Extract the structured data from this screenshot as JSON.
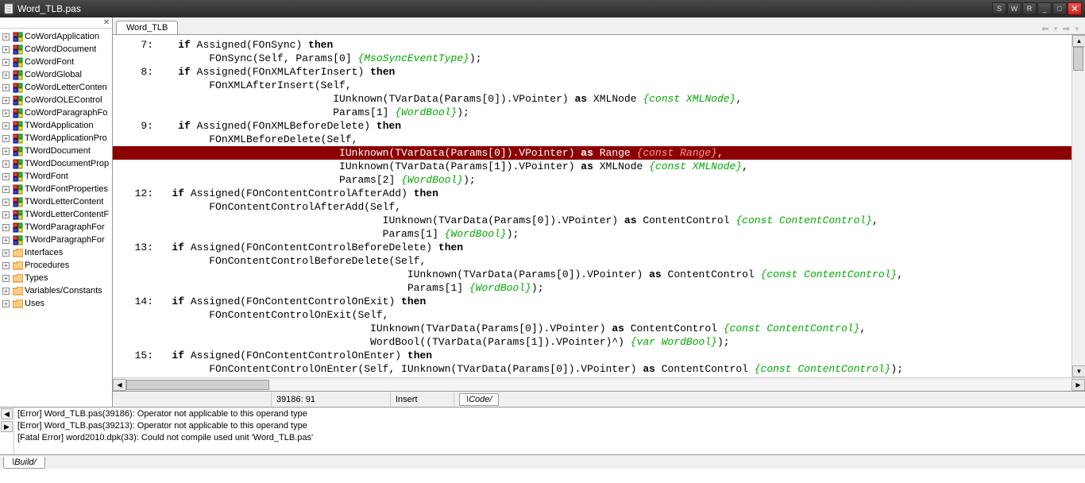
{
  "titlebar": {
    "title": "Word_TLB.pas",
    "buttons": {
      "s": "S",
      "w": "W",
      "r": "R",
      "min": "_",
      "max": "□",
      "close": "✕"
    }
  },
  "tree": [
    {
      "label": "CoWordApplication",
      "icon": "class"
    },
    {
      "label": "CoWordDocument",
      "icon": "class"
    },
    {
      "label": "CoWordFont",
      "icon": "class"
    },
    {
      "label": "CoWordGlobal",
      "icon": "class"
    },
    {
      "label": "CoWordLetterConten",
      "icon": "class"
    },
    {
      "label": "CoWordOLEControl",
      "icon": "class"
    },
    {
      "label": "CoWordParagraphFo",
      "icon": "class"
    },
    {
      "label": "TWordApplication",
      "icon": "class"
    },
    {
      "label": "TWordApplicationPro",
      "icon": "class"
    },
    {
      "label": "TWordDocument",
      "icon": "class"
    },
    {
      "label": "TWordDocumentProp",
      "icon": "class"
    },
    {
      "label": "TWordFont",
      "icon": "class"
    },
    {
      "label": "TWordFontProperties",
      "icon": "class"
    },
    {
      "label": "TWordLetterContent",
      "icon": "class"
    },
    {
      "label": "TWordLetterContentF",
      "icon": "class"
    },
    {
      "label": "TWordParagraphFor",
      "icon": "class"
    },
    {
      "label": "TWordParagraphFor",
      "icon": "class"
    },
    {
      "label": "Interfaces",
      "icon": "folder"
    },
    {
      "label": "Procedures",
      "icon": "folder"
    },
    {
      "label": "Types",
      "icon": "folder"
    },
    {
      "label": "Variables/Constants",
      "icon": "folder"
    },
    {
      "label": "Uses",
      "icon": "folder"
    }
  ],
  "tab": {
    "label": "Word_TLB"
  },
  "code": [
    {
      "n": "7",
      "pre": "   ",
      "t": [
        [
          "kw",
          "if"
        ],
        [
          "",
          " Assigned(FOnSync) "
        ],
        [
          "kw",
          "then"
        ]
      ]
    },
    {
      "pre": "        ",
      "t": [
        [
          "",
          "FOnSync(Self, Params[0] "
        ],
        [
          "cm",
          "{MsoSyncEventType}"
        ],
        [
          "",
          ");"
        ]
      ]
    },
    {
      "n": "8",
      "pre": "   ",
      "t": [
        [
          "kw",
          "if"
        ],
        [
          "",
          " Assigned(FOnXMLAfterInsert) "
        ],
        [
          "kw",
          "then"
        ]
      ]
    },
    {
      "pre": "        ",
      "t": [
        [
          "",
          "FOnXMLAfterInsert(Self,"
        ]
      ]
    },
    {
      "pre": "                            ",
      "t": [
        [
          "",
          "IUnknown(TVarData(Params[0]).VPointer) "
        ],
        [
          "kw",
          "as"
        ],
        [
          "",
          " XMLNode "
        ],
        [
          "cm",
          "{const XMLNode}"
        ],
        [
          "",
          ","
        ]
      ]
    },
    {
      "pre": "                            ",
      "t": [
        [
          "",
          "Params[1] "
        ],
        [
          "cm",
          "{WordBool}"
        ],
        [
          "",
          ");"
        ]
      ]
    },
    {
      "n": "9",
      "pre": "   ",
      "t": [
        [
          "kw",
          "if"
        ],
        [
          "",
          " Assigned(FOnXMLBeforeDelete) "
        ],
        [
          "kw",
          "then"
        ]
      ]
    },
    {
      "pre": "        ",
      "t": [
        [
          "",
          "FOnXMLBeforeDelete(Self,"
        ]
      ]
    },
    {
      "hl": true,
      "pre": "                             ",
      "t": [
        [
          "",
          "IUnknown(TVarData(Params[0]).VPointer) "
        ],
        [
          "kw",
          "as"
        ],
        [
          "",
          " Range "
        ],
        [
          "cm",
          "{const Range}"
        ],
        [
          "",
          ","
        ]
      ]
    },
    {
      "pre": "                             ",
      "t": [
        [
          "",
          "IUnknown(TVarData(Params[1]).VPointer) "
        ],
        [
          "kw",
          "as"
        ],
        [
          "",
          " XMLNode "
        ],
        [
          "cm",
          "{const XMLNode}"
        ],
        [
          "",
          ","
        ]
      ]
    },
    {
      "pre": "                             ",
      "t": [
        [
          "",
          "Params[2] "
        ],
        [
          "cm",
          "{WordBool}"
        ],
        [
          "",
          ");"
        ]
      ]
    },
    {
      "n": "12",
      "pre": "  ",
      "t": [
        [
          "kw",
          "if"
        ],
        [
          "",
          " Assigned(FOnContentControlAfterAdd) "
        ],
        [
          "kw",
          "then"
        ]
      ]
    },
    {
      "pre": "        ",
      "t": [
        [
          "",
          "FOnContentControlAfterAdd(Self,"
        ]
      ]
    },
    {
      "pre": "                                    ",
      "t": [
        [
          "",
          "IUnknown(TVarData(Params[0]).VPointer) "
        ],
        [
          "kw",
          "as"
        ],
        [
          "",
          " ContentControl "
        ],
        [
          "cm",
          "{const ContentControl}"
        ],
        [
          "",
          ","
        ]
      ]
    },
    {
      "pre": "                                    ",
      "t": [
        [
          "",
          "Params[1] "
        ],
        [
          "cm",
          "{WordBool}"
        ],
        [
          "",
          ");"
        ]
      ]
    },
    {
      "n": "13",
      "pre": "  ",
      "t": [
        [
          "kw",
          "if"
        ],
        [
          "",
          " Assigned(FOnContentControlBeforeDelete) "
        ],
        [
          "kw",
          "then"
        ]
      ]
    },
    {
      "pre": "        ",
      "t": [
        [
          "",
          "FOnContentControlBeforeDelete(Self,"
        ]
      ]
    },
    {
      "pre": "                                        ",
      "t": [
        [
          "",
          "IUnknown(TVarData(Params[0]).VPointer) "
        ],
        [
          "kw",
          "as"
        ],
        [
          "",
          " ContentControl "
        ],
        [
          "cm",
          "{const ContentControl}"
        ],
        [
          "",
          ","
        ]
      ]
    },
    {
      "pre": "                                        ",
      "t": [
        [
          "",
          "Params[1] "
        ],
        [
          "cm",
          "{WordBool}"
        ],
        [
          "",
          ");"
        ]
      ]
    },
    {
      "n": "14",
      "pre": "  ",
      "t": [
        [
          "kw",
          "if"
        ],
        [
          "",
          " Assigned(FOnContentControlOnExit) "
        ],
        [
          "kw",
          "then"
        ]
      ]
    },
    {
      "pre": "        ",
      "t": [
        [
          "",
          "FOnContentControlOnExit(Self,"
        ]
      ]
    },
    {
      "pre": "                                  ",
      "t": [
        [
          "",
          "IUnknown(TVarData(Params[0]).VPointer) "
        ],
        [
          "kw",
          "as"
        ],
        [
          "",
          " ContentControl "
        ],
        [
          "cm",
          "{const ContentControl}"
        ],
        [
          "",
          ","
        ]
      ]
    },
    {
      "pre": "                                  ",
      "t": [
        [
          "",
          "WordBool((TVarData(Params[1]).VPointer)^) "
        ],
        [
          "cm",
          "{var WordBool}"
        ],
        [
          "",
          ");"
        ]
      ]
    },
    {
      "n": "15",
      "pre": "  ",
      "t": [
        [
          "kw",
          "if"
        ],
        [
          "",
          " Assigned(FOnContentControlOnEnter) "
        ],
        [
          "kw",
          "then"
        ]
      ]
    },
    {
      "pre": "        ",
      "t": [
        [
          "",
          "FOnContentControlOnEnter(Self, IUnknown(TVarData(Params[0]).VPointer) "
        ],
        [
          "kw",
          "as"
        ],
        [
          "",
          " ContentControl "
        ],
        [
          "cm",
          "{const ContentControl}"
        ],
        [
          "",
          ");"
        ]
      ]
    }
  ],
  "status": {
    "pos": "39186: 91",
    "mode": "Insert",
    "codetab": "Code"
  },
  "messages": [
    "[Error] Word_TLB.pas(39186): Operator not applicable to this operand type",
    "[Error] Word_TLB.pas(39213): Operator not applicable to this operand type",
    "[Fatal Error] word2010.dpk(33): Could not compile used unit 'Word_TLB.pas'"
  ],
  "bottomtab": "Build"
}
